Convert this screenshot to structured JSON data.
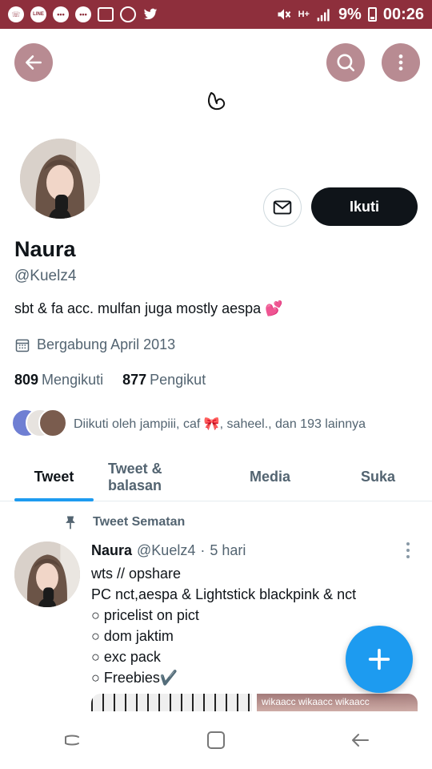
{
  "status_bar": {
    "network_badge": "H+",
    "battery": "9%",
    "time": "00:26",
    "line_label": "LINE",
    "icons": [
      "whatsapp-icon",
      "line-icon",
      "chat-icon",
      "chat-icon",
      "gallery-icon",
      "camera-icon",
      "twitter-icon",
      "mute-icon",
      "signal-icon",
      "battery-icon"
    ]
  },
  "colors": {
    "status_bar": "#8e2f3c",
    "header_button": "#b88b92",
    "accent": "#1d9bf0",
    "follow_button": "#0f1419",
    "secondary_text": "#536471"
  },
  "profile": {
    "name": "Naura",
    "handle": "@Kuelz4",
    "bio": "sbt & fa acc. mulfan juga mostly aespa 💕",
    "joined": "Bergabung April 2013",
    "following_count": "809",
    "following_label": "Mengikuti",
    "followers_count": "877",
    "followers_label": "Pengikut",
    "followed_by": "Diikuti oleh jampiii, caf 🎀, saheel., dan 193 lainnya",
    "follow_button": "Ikuti"
  },
  "tabs": [
    {
      "label": "Tweet",
      "active": true
    },
    {
      "label": "Tweet & balasan",
      "active": false
    },
    {
      "label": "Media",
      "active": false
    },
    {
      "label": "Suka",
      "active": false
    }
  ],
  "pinned_tweet": {
    "pinned_label": "Tweet Sematan",
    "author_name": "Naura",
    "author_handle": "@Kuelz4",
    "separator": "·",
    "time": "5 hari",
    "lines": [
      "wts // opshare",
      "PC nct,aespa & Lightstick blackpink & nct",
      "○ pricelist on pict",
      "○ dom jaktim",
      "○ exc pack",
      "○ Freebies✔️"
    ],
    "media_watermark": "wikaacc wikaacc wikaacc"
  }
}
